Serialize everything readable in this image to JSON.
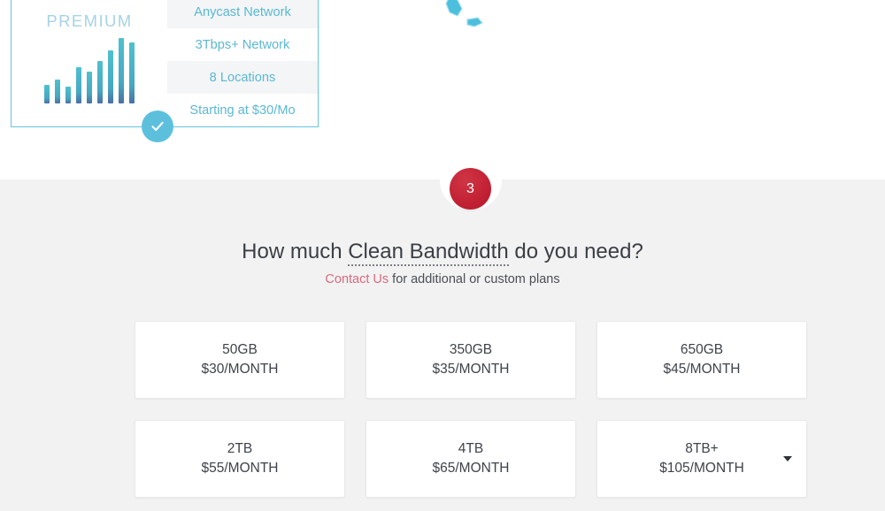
{
  "plan_card": {
    "title": "PREMIUM",
    "chart_icon": "bar-chart-icon",
    "features": [
      "Anycast Network",
      "3Tbps+ Network",
      "8 Locations",
      "Starting at $30/Mo"
    ],
    "selected": true,
    "check_icon": "check-icon",
    "accent_color": "#5cc0dd",
    "title_color": "#a6d3e4"
  },
  "map": {
    "icon": "world-map",
    "land_color": "#4cbfdd"
  },
  "step": {
    "number": "3",
    "badge_color": "#c22033"
  },
  "headings": {
    "title_part1": "How much ",
    "title_highlight": "Clean Bandwidth",
    "title_part2": " do you need?",
    "sub_link": "Contact Us",
    "sub_rest": " for additional or custom plans",
    "link_color": "#d96a7f"
  },
  "plans": [
    {
      "size": "50GB",
      "price": "$30/MONTH",
      "has_dropdown": false
    },
    {
      "size": "350GB",
      "price": "$35/MONTH",
      "has_dropdown": false
    },
    {
      "size": "650GB",
      "price": "$45/MONTH",
      "has_dropdown": false
    },
    {
      "size": "2TB",
      "price": "$55/MONTH",
      "has_dropdown": false
    },
    {
      "size": "4TB",
      "price": "$65/MONTH",
      "has_dropdown": false
    },
    {
      "size": "8TB+",
      "price": "$105/MONTH",
      "has_dropdown": true,
      "dropdown_icon": "chevron-down-icon"
    }
  ],
  "chart_data": {
    "type": "bar",
    "title": "",
    "categories": [
      "1",
      "2",
      "3",
      "4",
      "5",
      "6",
      "7",
      "8",
      "9"
    ],
    "values": [
      22,
      30,
      20,
      45,
      40,
      52,
      70,
      88,
      80
    ],
    "xlabel": "",
    "ylabel": "",
    "ylim": [
      0,
      100
    ],
    "grid": false,
    "legend": "none",
    "bar_color_top": "#49b6c8",
    "bar_color_bottom": "#4a6fa5"
  }
}
